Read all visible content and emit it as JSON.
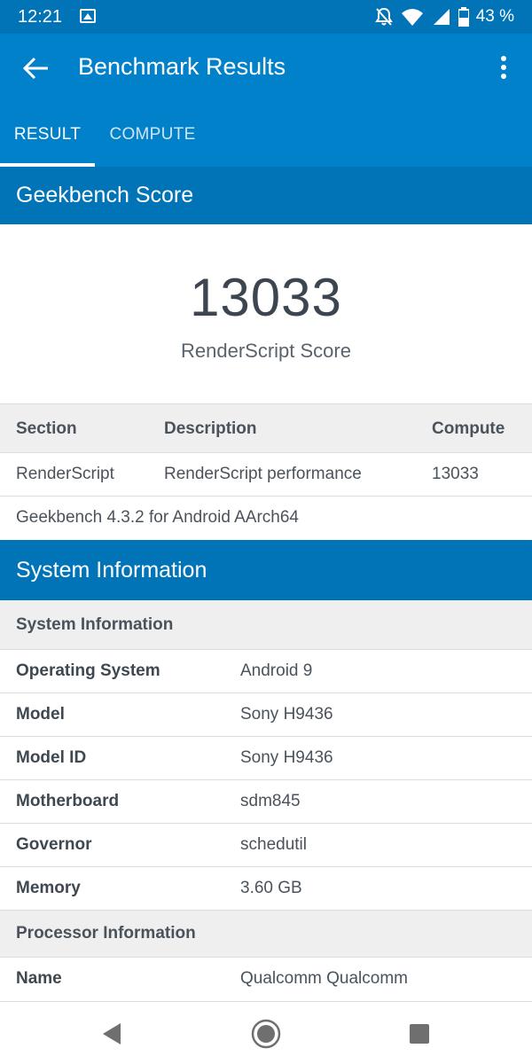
{
  "status_bar": {
    "time": "12:21",
    "battery": "43 %"
  },
  "app_bar": {
    "title": "Benchmark Results"
  },
  "tabs": [
    {
      "label": "RESULT",
      "active": true
    },
    {
      "label": "COMPUTE",
      "active": false
    }
  ],
  "score_section": {
    "header": "Geekbench Score",
    "score": "13033",
    "score_label": "RenderScript Score"
  },
  "results_table": {
    "columns": [
      "Section",
      "Description",
      "Compute"
    ],
    "rows": [
      [
        "RenderScript",
        "RenderScript performance",
        "13033"
      ]
    ],
    "footer": "Geekbench 4.3.2 for Android AArch64"
  },
  "system_section": {
    "header": "System Information",
    "system_subheader": "System Information",
    "system_items": [
      {
        "key": "Operating System",
        "value": "Android 9"
      },
      {
        "key": "Model",
        "value": "Sony H9436"
      },
      {
        "key": "Model ID",
        "value": "Sony H9436"
      },
      {
        "key": "Motherboard",
        "value": "sdm845"
      },
      {
        "key": "Governor",
        "value": "schedutil"
      },
      {
        "key": "Memory",
        "value": "3.60 GB"
      }
    ],
    "processor_subheader": "Processor Information",
    "processor_items": [
      {
        "key": "Name",
        "value": "Qualcomm Qualcomm"
      }
    ]
  },
  "icons": {
    "status": [
      "image-icon",
      "mute-icon",
      "wifi-icon",
      "signal-icon",
      "battery-icon"
    ],
    "app_bar": [
      "back-arrow-icon",
      "overflow-menu-icon"
    ],
    "nav": [
      "back-triangle-icon",
      "home-circle-icon",
      "recents-square-icon"
    ]
  },
  "colors": {
    "status_bar": "#0174b8",
    "app_bar": "#0181c9",
    "section_header": "#0174b8",
    "subheader_bg": "#efefef",
    "text": "#4a535c"
  }
}
